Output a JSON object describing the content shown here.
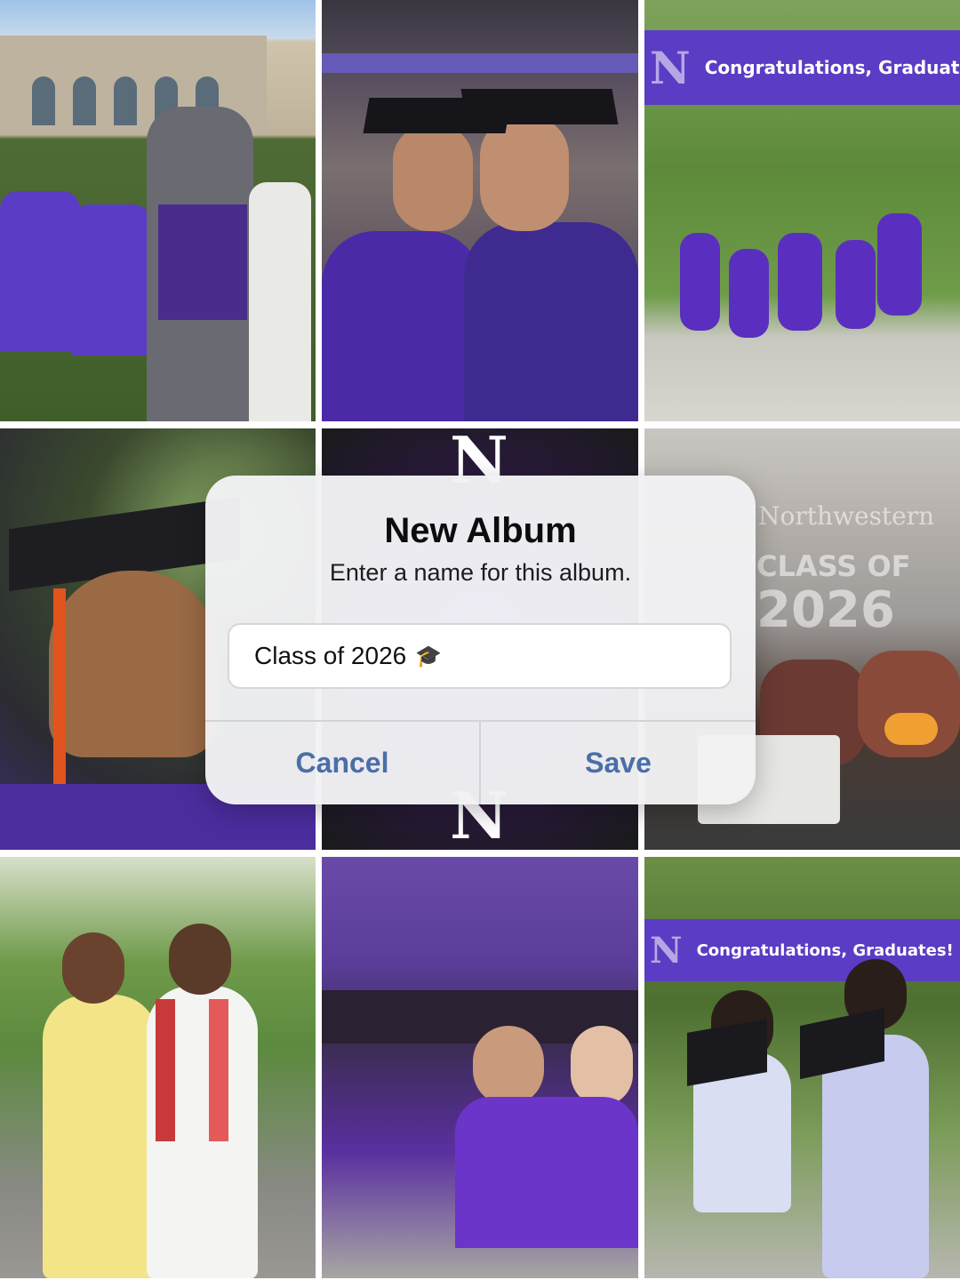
{
  "photos": {
    "p3_banner": "Congratulations, Graduates",
    "p6_sign_name": "Northwestern",
    "p6_sign_class": "CLASS OF",
    "p6_sign_year": "2026",
    "p9_banner": "Congratulations, Graduates!",
    "n_letter": "N"
  },
  "dialog": {
    "title": "New Album",
    "message": "Enter a name for this album.",
    "input_value": "Class of 2026",
    "input_icon": "🎓",
    "cancel_label": "Cancel",
    "save_label": "Save"
  },
  "colors": {
    "accent": "#4a6ea8",
    "brand_purple": "#5b3cc4"
  },
  "icons": {
    "input_trailing": "graduation-cap-icon"
  }
}
